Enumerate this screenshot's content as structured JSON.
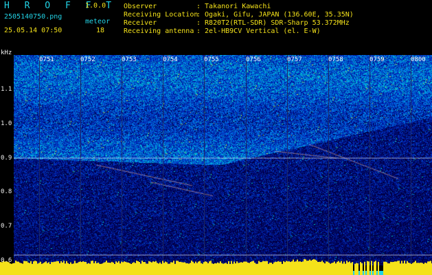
{
  "header": {
    "brand": "H R O F F T",
    "version": "1.0.0",
    "file_name": "2505140750.png",
    "meteor_label": "meteor",
    "timestamp": "25.05.14 07:50",
    "meteor_count": "18"
  },
  "info": [
    {
      "key": "Observer",
      "value": ": Takanori Kawachi"
    },
    {
      "key": "Receiving Location",
      "value": ": Ogaki, Gifu, JAPAN (136.60E, 35.35N)"
    },
    {
      "key": "Receiver",
      "value": ": R820T2(RTL-SDR) SDR-Sharp 53.372MHz"
    },
    {
      "key": "Receiving antenna",
      "value": ": 2el-HB9CV Vertical (el. E-W)"
    }
  ],
  "axis": {
    "unit": "kHz",
    "y_labels": [
      "1.1",
      "1.0",
      "0.9",
      "0.8",
      "0.7",
      "0.6"
    ],
    "time_ticks": [
      "0751",
      "0752",
      "0753",
      "0754",
      "0755",
      "0756",
      "0757",
      "0758",
      "0759",
      "0800"
    ]
  },
  "colors": {
    "background": "#000000",
    "accent_cyan": "#22d3e6",
    "accent_yellow": "#f4e21a",
    "signal_line": "#ffffff"
  }
}
